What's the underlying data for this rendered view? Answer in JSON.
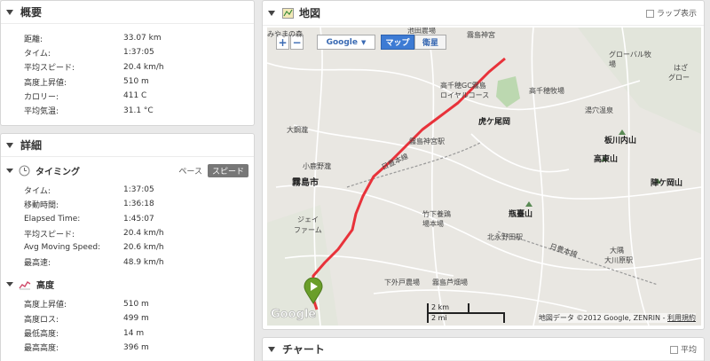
{
  "overview": {
    "title": "概要",
    "rows": [
      {
        "label": "距離:",
        "value": "33.07 km"
      },
      {
        "label": "タイム:",
        "value": "1:37:05"
      },
      {
        "label": "平均スピード:",
        "value": "20.4 km/h"
      },
      {
        "label": "高度上昇値:",
        "value": "510 m"
      },
      {
        "label": "カロリー:",
        "value": "411 C"
      },
      {
        "label": "平均気温:",
        "value": "31.1 °C"
      }
    ]
  },
  "details": {
    "title": "詳細",
    "timing": {
      "title": "タイミング",
      "pace_label": "ペース",
      "speed_label": "スピード",
      "rows": [
        {
          "label": "タイム:",
          "value": "1:37:05"
        },
        {
          "label": "移動時間:",
          "value": "1:36:18"
        },
        {
          "label": "Elapsed Time:",
          "value": "1:45:07"
        },
        {
          "label": "平均スピード:",
          "value": "20.4 km/h"
        },
        {
          "label": "Avg Moving Speed:",
          "value": "20.6 km/h"
        },
        {
          "label": "最高速:",
          "value": "48.9 km/h"
        }
      ]
    },
    "elevation": {
      "title": "高度",
      "rows": [
        {
          "label": "高度上昇値:",
          "value": "510 m"
        },
        {
          "label": "高度ロス:",
          "value": "499 m"
        },
        {
          "label": "最低高度:",
          "value": "14 m"
        },
        {
          "label": "最高高度:",
          "value": "396 m"
        }
      ]
    }
  },
  "map": {
    "title": "地図",
    "lap_label": "ラップ表示",
    "zoom_in": "+",
    "zoom_out": "−",
    "provider": "Google",
    "map_tab": "マップ",
    "satellite_tab": "衛星",
    "scale_km": "2 km",
    "scale_mi": "2 mi",
    "copyright": "地図データ ©2012 Google, ZENRIN -",
    "terms": "利用規約",
    "watermark": "Google",
    "labels": [
      "霧島神宮",
      "池田農場",
      "みやまの森",
      "グローバル牧場",
      "はざ",
      "グロー",
      "高千穂GC霧島",
      "ロイヤルコース",
      "高千穂牧場",
      "虎ケ尾岡",
      "湯穴温泉",
      "大鋼瀧",
      "板川内山",
      "霧島神宮駅",
      "高東山",
      "小鹿野瀧",
      "日豊本線",
      "霧島市",
      "陣ケ岡山",
      "ジェイ",
      "ファーム",
      "竹下養鶏",
      "場本場",
      "瓶臺山",
      "北永野田駅",
      "日豊本線",
      "大隅",
      "大川原駅",
      "下外戸農場",
      "霧島芦畑場"
    ]
  },
  "chart": {
    "title": "チャート",
    "avg_label": "平均"
  }
}
